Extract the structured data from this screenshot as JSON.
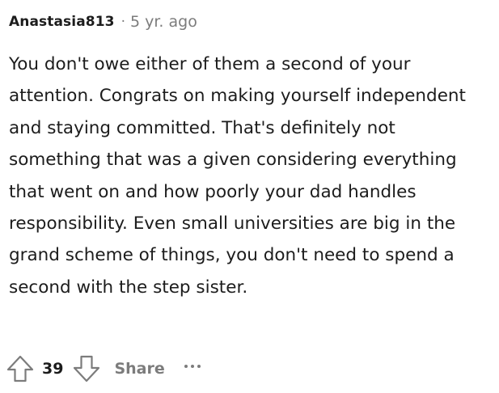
{
  "comment": {
    "author": "Anastasia813",
    "separator": "·",
    "timestamp": "5 yr. ago",
    "body": "You don't owe either of them a second of your attention. Congrats on making yourself independent and staying committed. That's definitely not something that was a given considering everything that went on and how poorly your dad handles responsibility. Even small universities are big in the grand scheme of things, you don't need to spend a second with the step sister.",
    "score": "39",
    "share_label": "Share"
  },
  "icons": {
    "upvote": "upvote-arrow-icon",
    "downvote": "downvote-arrow-icon",
    "more": "more-options-icon"
  },
  "colors": {
    "text": "#1c1c1c",
    "muted": "#7c7c7c",
    "background": "#ffffff"
  }
}
